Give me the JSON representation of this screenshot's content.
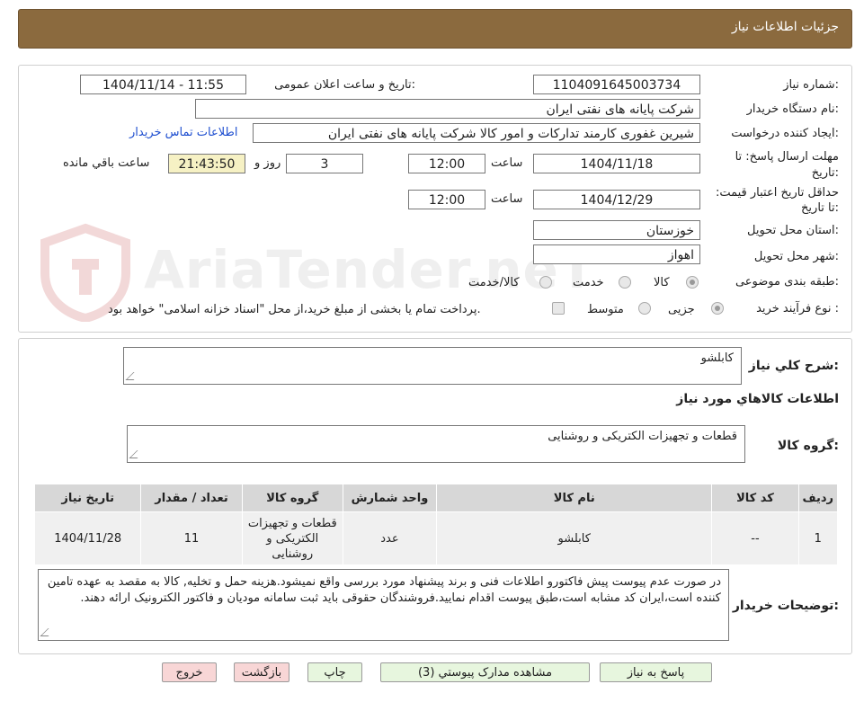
{
  "header": {
    "title": "جزئیات اطلاعات نیاز"
  },
  "watermark": "AriaTender.neT",
  "info": {
    "need_number_label": "شماره نیاز:",
    "need_number": "1104091645003734",
    "announce_label": "تاریخ و ساعت اعلان عمومی:",
    "announce_value": "1404/11/14 - 11:55",
    "buyer_label": "نام دستگاه خریدار:",
    "buyer_value": "شرکت پایانه های نفتی ایران",
    "creator_label": "ایجاد کننده درخواست:",
    "creator_value": "شیرین غفوری کارمند تدارکات و امور کالا شرکت پایانه های نفتی ایران",
    "contact_link": "اطلاعات تماس خریدار",
    "deadline_label": "مهلت ارسال پاسخ: تا تاریخ:",
    "deadline_date": "1404/11/18",
    "time_label": "ساعت",
    "deadline_time": "12:00",
    "days_value": "3",
    "days_label": "روز و",
    "remaining_time": "21:43:50",
    "remaining_label": "ساعت باقي مانده",
    "validity_label": "حداقل تاریخ اعتبار قیمت: تا تاریخ:",
    "validity_date": "1404/12/29",
    "validity_time": "12:00",
    "province_label": "استان محل تحویل:",
    "province_value": "خوزستان",
    "city_label": "شهر محل تحویل:",
    "city_value": "اهواز",
    "category_label": "طبقه بندی موضوعی:",
    "category_options": [
      "کالا",
      "خدمت",
      "کالا/خدمت"
    ],
    "process_label": "نوع فرآیند خرید :",
    "process_options": [
      "جزیی",
      "متوسط"
    ],
    "payment_note": "پرداخت تمام یا بخشی از مبلغ خرید،از محل \"اسناد خزانه اسلامی\" خواهد بود."
  },
  "details": {
    "summary_label": "شرح كلي نياز:",
    "summary_value": "کابلشو",
    "goods_info_title": "اطلاعات كالاهاي مورد نياز",
    "group_label": "گروه کالا:",
    "group_value": "قطعات و تجهیزات الکتریکی و روشنایی",
    "table": {
      "headers": [
        "ردیف",
        "کد کالا",
        "نام کالا",
        "واحد شمارش",
        "گروه کالا",
        "تعداد / مقدار",
        "تاریخ نیاز"
      ],
      "rows": [
        [
          "1",
          "--",
          "کابلشو",
          "عدد",
          "قطعات و تجهیزات الکتریکی و روشنایی",
          "11",
          "1404/11/28"
        ]
      ]
    },
    "buyer_notes_label": "توضیحات خریدار:",
    "buyer_notes_value": "در صورت عدم پیوست پیش فاکتورو اطلاعات فنی  و برند پیشنهاد مورد بررسی واقع نمیشود.هزینه حمل و تخلیه, کالا به مقصد به عهده تامین کننده است،ایران کد مشابه است،طبق پیوست اقدام نمایید.فروشندگان حقوقی باید ثبت سامانه مودیان و فاکتور الکترونیک ارائه دهند."
  },
  "buttons": {
    "reply": "پاسخ به نیاز",
    "attachments": "مشاهده مدارک پیوستي (3)",
    "print": "چاپ",
    "back": "بازگشت",
    "exit": "خروج"
  }
}
